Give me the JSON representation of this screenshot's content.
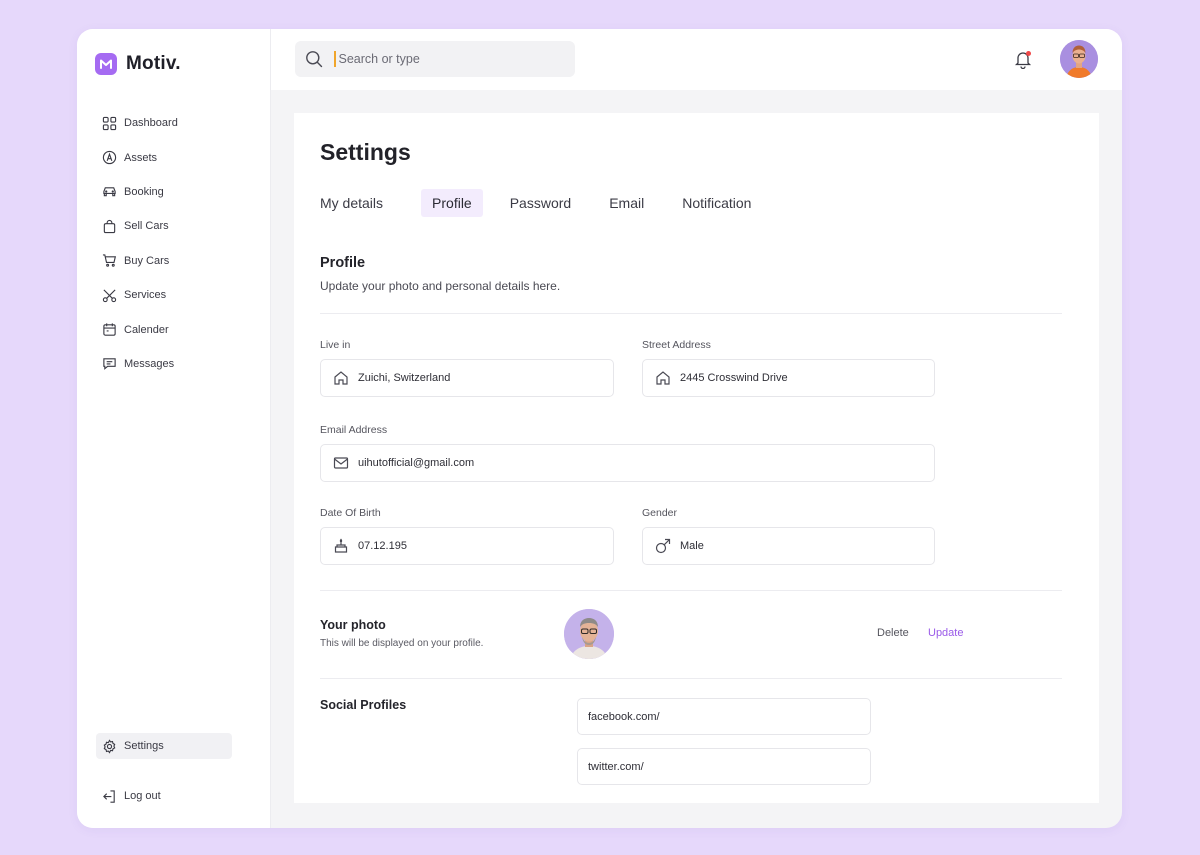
{
  "brand": {
    "name": "Motiv."
  },
  "sidebar": {
    "items": [
      {
        "label": "Dashboard",
        "icon": "dashboard-grid-icon"
      },
      {
        "label": "Assets",
        "icon": "assets-circle-icon"
      },
      {
        "label": "Booking",
        "icon": "car-icon"
      },
      {
        "label": "Sell Cars",
        "icon": "shopping-bag-icon"
      },
      {
        "label": "Buy Cars",
        "icon": "cart-icon"
      },
      {
        "label": "Services",
        "icon": "scissors-icon"
      },
      {
        "label": "Calender",
        "icon": "calendar-icon"
      },
      {
        "label": "Messages",
        "icon": "message-icon"
      }
    ],
    "settings_label": "Settings",
    "logout_label": "Log out"
  },
  "search": {
    "placeholder": "Search or type"
  },
  "page": {
    "title": "Settings",
    "tabs": [
      "My details",
      "Profile",
      "Password",
      "Email",
      "Notification"
    ],
    "active_tab": "Profile"
  },
  "profile": {
    "title": "Profile",
    "subtitle": "Update your photo and personal details here.",
    "live_in": {
      "label": "Live in",
      "value": "Zuichi, Switzerland"
    },
    "street": {
      "label": "Street Address",
      "value": "2445 Crosswind Drive"
    },
    "email": {
      "label": "Email Address",
      "value": "uihutofficial@gmail.com"
    },
    "dob": {
      "label": "Date Of Birth",
      "value": "07.12.195"
    },
    "gender": {
      "label": "Gender",
      "value": "Male"
    }
  },
  "photo": {
    "title": "Your photo",
    "subtitle": "This will be displayed on your profile.",
    "delete_label": "Delete",
    "update_label": "Update"
  },
  "social": {
    "title": "Social Profiles",
    "facebook": "facebook.com/",
    "twitter": "twitter.com/"
  },
  "colors": {
    "accent": "#a56bf2",
    "update": "#9a5ae8",
    "background": "#e6d8fb"
  }
}
